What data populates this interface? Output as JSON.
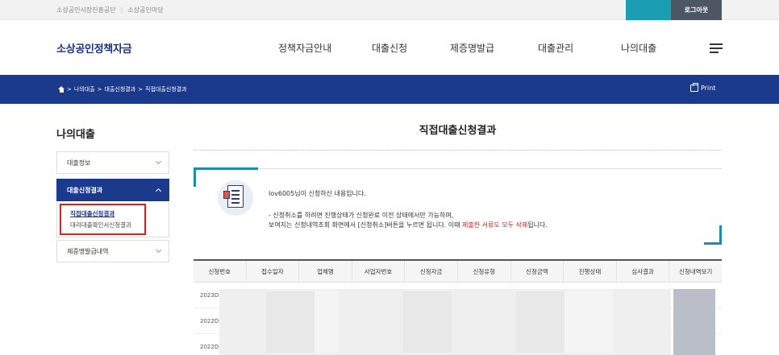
{
  "topbar": {
    "links": [
      "소상공인시장진흥공단",
      "소상공인마당"
    ],
    "separator": "|",
    "logout_label": "로그아웃",
    "accent_color": "#1b9db3"
  },
  "header": {
    "logo": "소상공인정책자금",
    "nav": [
      "정책자금안내",
      "대출신청",
      "제증명발급",
      "대출관리",
      "나의대출"
    ],
    "brand_color": "#17328a"
  },
  "breadcrumb": {
    "items": [
      "나의대출",
      "대출신청결과",
      "직접대출신청결과"
    ],
    "separator": ">",
    "print_label": "Print",
    "band_color": "#1c3a8c"
  },
  "sidebar": {
    "title": "나의대출",
    "items": [
      {
        "label": "대출정보"
      },
      {
        "label": "대출신청결과"
      },
      {
        "label": "제증명발급내역"
      }
    ],
    "subitems": [
      "직접대출신청결과",
      "대리대출확인서신청결과"
    ]
  },
  "main": {
    "title": "직접대출신청결과",
    "notice": {
      "line1": "lov6005님이 신청하신 내용입니다.",
      "line2": "- 신청취소를 하려면 진행상태가 신청완료 이전 상태에서만 가능하며,",
      "line3_a": "보여지는 신청내역조회 화면에서 [신청취소]버튼을 누르면 됩니다. 이때 ",
      "line3_red": "제출한 서류도 모두 삭제",
      "line3_b": "됩니다."
    },
    "table": {
      "headers": [
        "신청번호",
        "접수일자",
        "업체명",
        "사업자번호",
        "신청자금",
        "신청유형",
        "신청금액",
        "진행상태",
        "심사결과",
        "신청내역보기"
      ],
      "rows": [
        {
          "id": "2023D2"
        },
        {
          "id": "2022D1"
        },
        {
          "id": "2022D1"
        }
      ]
    }
  }
}
